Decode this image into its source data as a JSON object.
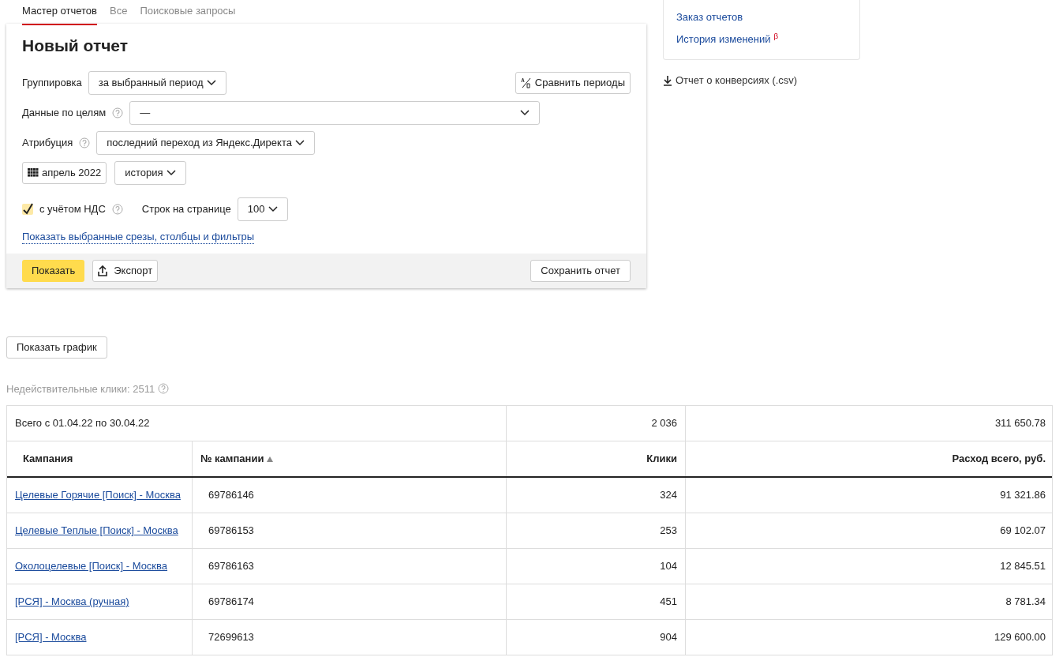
{
  "tabs": [
    {
      "label": "Мастер отчетов",
      "selected": true
    },
    {
      "label": "Все",
      "selected": false
    },
    {
      "label": "Поисковые запросы",
      "selected": false
    }
  ],
  "report": {
    "title": "Новый отчет",
    "grouping": {
      "label": "Группировка",
      "value": "за выбранный период"
    },
    "compare_button": "Сравнить периоды",
    "goals": {
      "label": "Данные по целям",
      "value": "—"
    },
    "attribution": {
      "label": "Атрибуция",
      "value": "последний переход из Яндекс.Директа"
    },
    "period": "апрель 2022",
    "history": "история",
    "vat": {
      "label": "с учётом НДС",
      "checked": true
    },
    "rows_per_page": {
      "label": "Строк на странице",
      "value": "100"
    },
    "show_filters_link": "Показать выбранные срезы, столбцы и фильтры",
    "show_button": "Показать",
    "export_button": "Экспорт",
    "save_button": "Сохранить отчет"
  },
  "side_links": [
    {
      "label": "Заказ отчетов"
    },
    {
      "label": "История изменений",
      "badge": "β"
    }
  ],
  "csv_link": "Отчет о конверсиях (.csv)",
  "chart_button": "Показать график",
  "invalid_clicks": "Недействительные клики: 2511",
  "table": {
    "total": {
      "label": "Всего с 01.04.22 по 30.04.22",
      "clicks": "2 036",
      "cost": "311 650.78"
    },
    "columns": [
      {
        "label": "Кампания",
        "sorted": false
      },
      {
        "label": "№ кампании",
        "sorted": true
      },
      {
        "label": "Клики",
        "sorted": false
      },
      {
        "label": "Расход всего, руб.",
        "sorted": false
      }
    ],
    "rows": [
      {
        "campaign": "Целевые Горячие [Поиск] - Москва",
        "id": "69786146",
        "clicks": "324",
        "cost": "91 321.86"
      },
      {
        "campaign": "Целевые Теплые [Поиск] - Москва",
        "id": "69786153",
        "clicks": "253",
        "cost": "69 102.07"
      },
      {
        "campaign": "Околоцелевые [Поиск] - Москва",
        "id": "69786163",
        "clicks": "104",
        "cost": "12 845.51"
      },
      {
        "campaign": "[РСЯ] - Москва (ручная)",
        "id": "69786174",
        "clicks": "451",
        "cost": "8 781.34"
      },
      {
        "campaign": "[РСЯ] - Москва",
        "id": "72699613",
        "clicks": "904",
        "cost": "129 600.00"
      }
    ]
  }
}
